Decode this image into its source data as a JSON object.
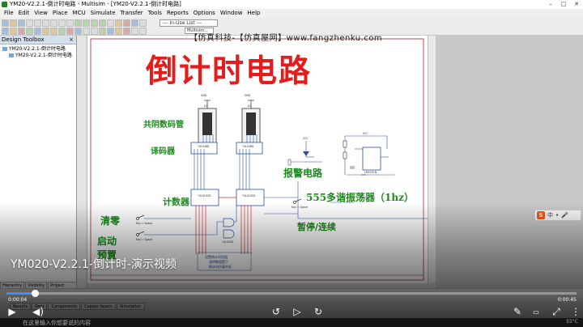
{
  "window": {
    "title": "YM20-V2.2.1-倒计时电路 - Multisim - [YM20-V2.2.1-倒计时电路]",
    "controls": [
      "–",
      "□",
      "✕"
    ]
  },
  "menu": [
    "File",
    "Edit",
    "View",
    "Place",
    "MCU",
    "Simulate",
    "Transfer",
    "Tools",
    "Reports",
    "Options",
    "Window",
    "Help"
  ],
  "toolbar": {
    "in_use_list": "--- In-Use List ---",
    "search_hint": "Multisim..."
  },
  "toolbox": {
    "title": "Design Toolbox",
    "close": "×",
    "tree": [
      "YM20-V2.2.1-倒计时电路",
      "YM20-V2.2.1-倒计时电路"
    ],
    "tabs": [
      "Hierarchy",
      "Visibility",
      "Project View"
    ]
  },
  "sheet_tabs": [
    "Results",
    "Nets",
    "Components",
    "Copper layers",
    "Simulation"
  ],
  "schematic": {
    "watermark": "【仿真科技-【仿真屋网】www.fangzhenku.com",
    "title": "倒计时电路",
    "labels": {
      "display": "共阴数码管",
      "decoder": "译码器",
      "counter": "计数器",
      "alarm": "报警电路",
      "oscillator": "555多谐振荡器（1hz）",
      "pause": "暂停/连续",
      "clear": "清零",
      "start": "启动",
      "preset": "预置",
      "preset_note_1": "设置倒计时初值",
      "preset_note_2": "请将数值置于",
      "preset_note_3": "倒计时仿真时长"
    },
    "part_labels": {
      "u1": "U1",
      "u2": "U2",
      "u3": "74LS48D",
      "u4": "74LS48D",
      "u5": "74LS192D",
      "u6": "74LS192D",
      "u7": "74LS00D",
      "u8": "LM555CN",
      "keyspace1": "Key = Space",
      "keyspace2": "Key = Space",
      "keyspace3": "Key = Space",
      "vcc": "VCC",
      "gnd": "GND"
    }
  },
  "video": {
    "title": "YM020-V2.2.1-倒计时-演示视频",
    "current_time": "0:00:04",
    "duration": "0:00:45",
    "progress": 0.05,
    "subtitle": "在这里输入你想要说的内容",
    "tray_text": "55°C"
  },
  "ime": {
    "brand": "S",
    "items": [
      "中",
      "•",
      "🎤"
    ]
  }
}
